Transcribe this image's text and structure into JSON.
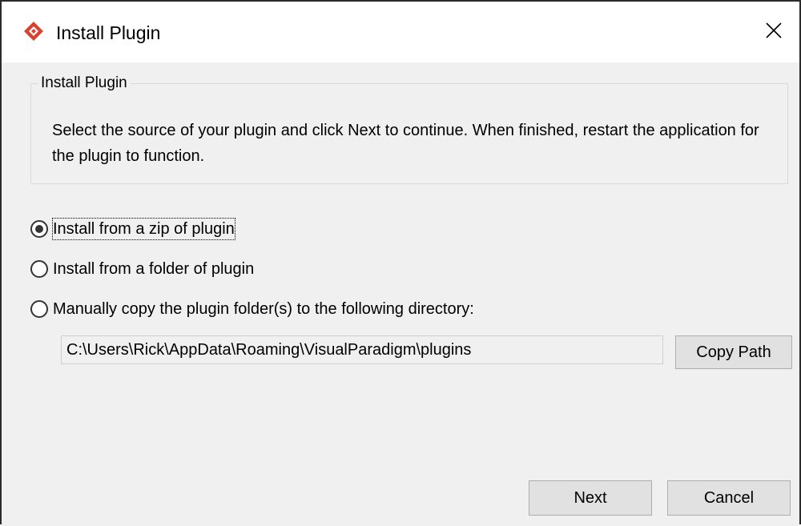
{
  "window": {
    "title": "Install Plugin",
    "app_icon": "visual-paradigm-logo-icon",
    "close_icon": "close-icon",
    "accent_color": "#d9412f"
  },
  "group": {
    "legend": "Install Plugin",
    "description": "Select the source of your plugin and click Next to continue. When finished, restart the application for the plugin to function."
  },
  "options": [
    {
      "label": "Install from a zip of plugin",
      "selected": true
    },
    {
      "label": "Install from a folder of plugin",
      "selected": false
    },
    {
      "label": "Manually copy the plugin folder(s) to the following directory:",
      "selected": false
    }
  ],
  "directory": {
    "path": "C:\\Users\\Rick\\AppData\\Roaming\\VisualParadigm\\plugins",
    "copy_label": "Copy Path"
  },
  "footer": {
    "next_label": "Next",
    "cancel_label": "Cancel"
  }
}
